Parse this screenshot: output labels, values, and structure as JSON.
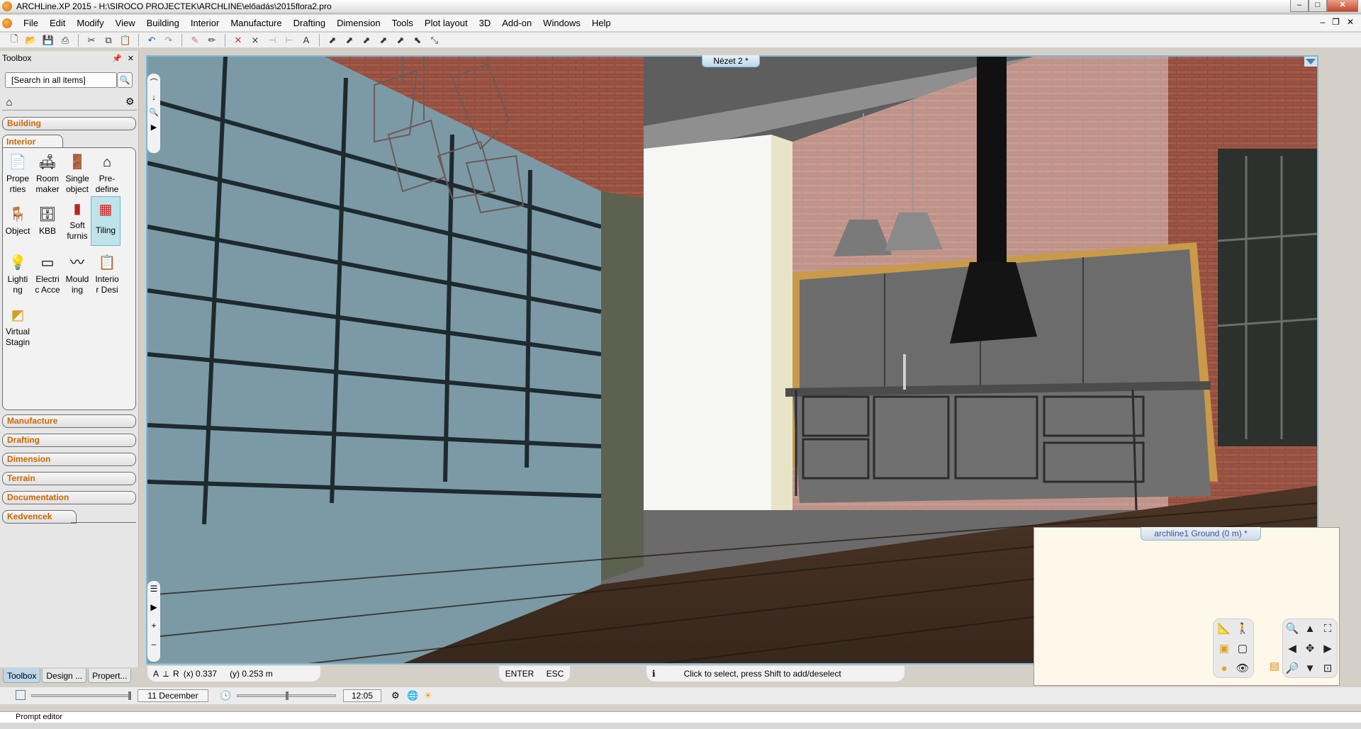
{
  "window": {
    "title": "ARCHLine.XP 2015 - H:\\SIROCO PROJECTEK\\ARCHLINE\\előadás\\2015flora2.pro"
  },
  "menu": {
    "items": [
      "File",
      "Edit",
      "Modify",
      "View",
      "Building",
      "Interior",
      "Manufacture",
      "Drafting",
      "Dimension",
      "Tools",
      "Plot layout",
      "3D",
      "Add-on",
      "Windows",
      "Help"
    ]
  },
  "toolbox": {
    "title": "Toolbox",
    "search_placeholder": "[Search in all items]",
    "categories": {
      "building": "Building",
      "interior": "Interior",
      "manufacture": "Manufacture",
      "drafting": "Drafting",
      "dimension": "Dimension",
      "terrain": "Terrain",
      "documentation": "Documentation",
      "kedvencek": "Kedvencek"
    },
    "tools": [
      {
        "label1": "Prope",
        "label2": "rties",
        "icon": "properties-icon"
      },
      {
        "label1": "Room",
        "label2": "maker",
        "icon": "room-maker-icon"
      },
      {
        "label1": "Single",
        "label2": "object",
        "icon": "single-object-icon"
      },
      {
        "label1": "Pre-",
        "label2": "define",
        "icon": "predefine-icon"
      },
      {
        "label1": "Object",
        "label2": "",
        "icon": "chair-icon"
      },
      {
        "label1": "KBB",
        "label2": "",
        "icon": "kbb-icon"
      },
      {
        "label1": "Soft",
        "label2": "furnis",
        "icon": "soft-furnishing-icon"
      },
      {
        "label1": "Tiling",
        "label2": "",
        "icon": "tiling-icon"
      },
      {
        "label1": "Lighti",
        "label2": "ng",
        "icon": "bulb-icon"
      },
      {
        "label1": "Electri",
        "label2": "c Acce",
        "icon": "electric-icon"
      },
      {
        "label1": "Mould",
        "label2": "ing",
        "icon": "moulding-icon"
      },
      {
        "label1": "Interio",
        "label2": "r Desi",
        "icon": "interior-design-icon"
      },
      {
        "label1": "Virtual",
        "label2": "Stagin",
        "icon": "virtual-staging-icon"
      }
    ]
  },
  "viewport": {
    "label": "Nézet 2 *",
    "plan_label": "archline1 Ground (0 m) *"
  },
  "bottom_tabs": [
    "Toolbox",
    "Design ...",
    "Propert..."
  ],
  "status": {
    "x": "(x) 0.337",
    "y": "(y) 0.253 m",
    "enter": "ENTER",
    "esc": "ESC",
    "message": "Click to select, press Shift to add/deselect"
  },
  "timebar": {
    "date": "11 December",
    "time": "12:05"
  },
  "prompt": {
    "label": "Prompt editor"
  },
  "colors": {
    "category_text": "#cc6600",
    "viewport_border": "#7fb8d8",
    "plan_bg": "#fdf8ea"
  }
}
